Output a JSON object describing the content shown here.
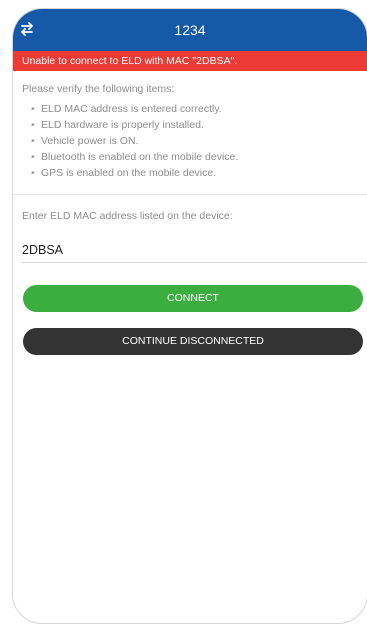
{
  "header": {
    "title": "1234",
    "left_icon": "swap-arrows-icon",
    "color": "#1659a8"
  },
  "error_banner": {
    "text": "Unable to connect to ELD with MAC \"2DBSA\".",
    "color": "#ec3a34"
  },
  "verify": {
    "heading": "Please verify the following items:",
    "items": [
      "ELD MAC address is entered correctly.",
      "ELD hardware is properly installed.",
      "Vehicle power is ON.",
      "Bluetooth is enabled on the mobile device.",
      "GPS is enabled on the mobile device."
    ]
  },
  "mac_field": {
    "label": "Enter ELD MAC address listed on the device:",
    "value": "2DBSA"
  },
  "buttons": {
    "connect": "CONNECT",
    "connect_color": "#3bae3f",
    "continue": "CONTINUE DISCONNECTED",
    "continue_color": "#333333"
  }
}
